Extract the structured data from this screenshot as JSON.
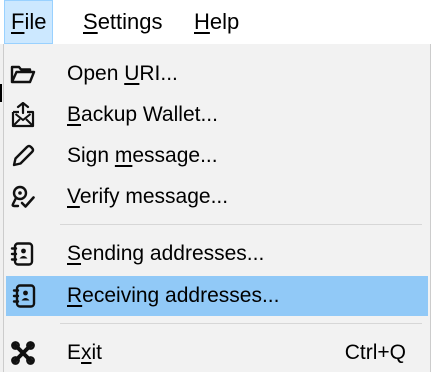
{
  "menubar": {
    "items": [
      {
        "pre": "",
        "mnemonic": "F",
        "post": "ile"
      },
      {
        "pre": "",
        "mnemonic": "S",
        "post": "ettings"
      },
      {
        "pre": "",
        "mnemonic": "H",
        "post": "elp"
      }
    ]
  },
  "file_menu": {
    "items": [
      {
        "pre": "Open ",
        "mnemonic": "U",
        "post": "RI...",
        "icon": "folder-open-icon"
      },
      {
        "pre": "",
        "mnemonic": "B",
        "post": "ackup Wallet...",
        "icon": "backup-icon"
      },
      {
        "pre": "Sign ",
        "mnemonic": "m",
        "post": "essage...",
        "icon": "pen-icon"
      },
      {
        "pre": "",
        "mnemonic": "V",
        "post": "erify message...",
        "icon": "verify-icon"
      },
      {
        "pre": "",
        "mnemonic": "S",
        "post": "ending addresses...",
        "icon": "address-book-icon"
      },
      {
        "pre": "",
        "mnemonic": "R",
        "post": "eceiving addresses...",
        "icon": "address-book-icon"
      },
      {
        "pre": "E",
        "mnemonic": "x",
        "post": "it",
        "icon": "quit-icon",
        "shortcut": "Ctrl+Q"
      }
    ],
    "highlighted_item": "Receiving addresses..."
  },
  "colors": {
    "menubar_active_bg": "#cce8ff",
    "menu_bg": "#f2f2f2",
    "highlight_bg": "#91c9f7"
  }
}
